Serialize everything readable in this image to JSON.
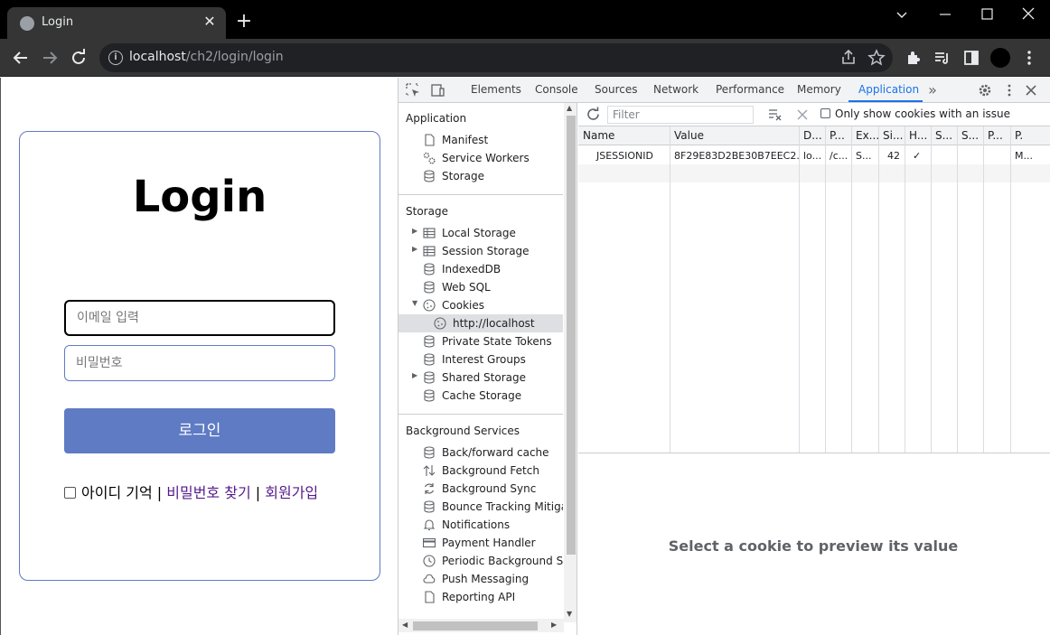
{
  "browser": {
    "tab_title": "Login",
    "new_tab": "+",
    "url_host": "localhost",
    "url_path": "/ch2/login/login"
  },
  "page": {
    "title": "Login",
    "email_placeholder": "이메일 입력",
    "password_placeholder": "비밀번호",
    "login_button": "로그인",
    "remember_label": "아이디 기억",
    "separator": "|",
    "find_password": "비밀번호 찾기",
    "signup": "회원가입",
    "accent_color": "#5f7bc4"
  },
  "devtools": {
    "tabs": [
      "Elements",
      "Console",
      "Sources",
      "Network",
      "Performance",
      "Memory",
      "Application"
    ],
    "active_tab": "Application",
    "more_tabs": "»",
    "sidebar": {
      "application_header": "Application",
      "application_items": [
        "Manifest",
        "Service Workers",
        "Storage"
      ],
      "storage_header": "Storage",
      "storage_items": [
        "Local Storage",
        "Session Storage",
        "IndexedDB",
        "Web SQL",
        "Cookies",
        "http://localhost",
        "Private State Tokens",
        "Interest Groups",
        "Shared Storage",
        "Cache Storage"
      ],
      "background_header": "Background Services",
      "background_items": [
        "Back/forward cache",
        "Background Fetch",
        "Background Sync",
        "Bounce Tracking Mitigatic",
        "Notifications",
        "Payment Handler",
        "Periodic Background Sync",
        "Push Messaging",
        "Reporting API"
      ]
    },
    "cookies": {
      "filter_placeholder": "Filter",
      "only_issue_label": "Only show cookies with an issue",
      "columns": [
        "Name",
        "Value",
        "D...",
        "P...",
        "Ex...",
        "Si...",
        "H...",
        "S...",
        "S...",
        "P...",
        "P."
      ],
      "rows": [
        [
          "JSESSIONID",
          "8F29E83D2BE30B7EEC2...",
          "lo...",
          "/c...",
          "S...",
          "42",
          "✓",
          "",
          "",
          "",
          "M..."
        ]
      ],
      "preview_message": "Select a cookie to preview its value"
    }
  }
}
